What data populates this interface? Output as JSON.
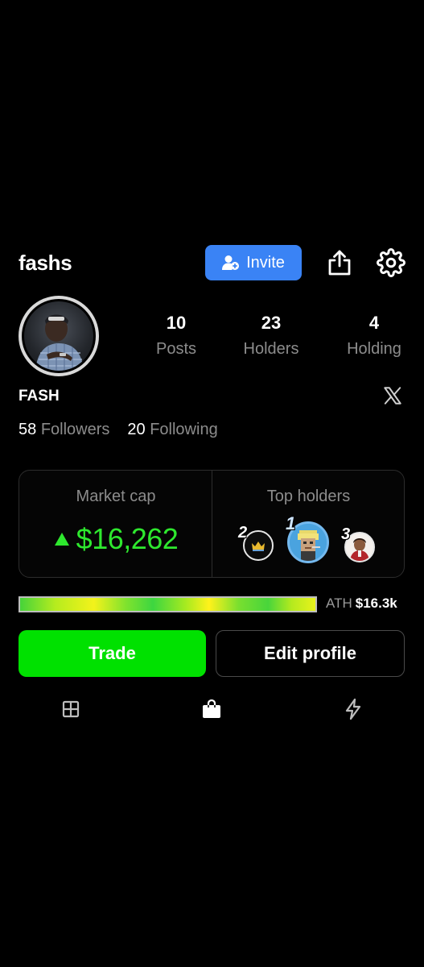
{
  "header": {
    "username": "fashs",
    "invite_label": "Invite",
    "share_icon": "share-icon",
    "settings_icon": "gear-icon",
    "accent_color": "#3a83f5"
  },
  "profile": {
    "display_name": "FASH",
    "stats": [
      {
        "value": "10",
        "label": "Posts"
      },
      {
        "value": "23",
        "label": "Holders"
      },
      {
        "value": "4",
        "label": "Holding"
      }
    ],
    "followers": {
      "count": "58",
      "label": "Followers"
    },
    "following": {
      "count": "20",
      "label": "Following"
    },
    "social_icon": "x-icon"
  },
  "market": {
    "market_cap_label": "Market cap",
    "market_cap_value": "$16,262",
    "trend": "up",
    "trend_color": "#2ee82e",
    "top_holders_label": "Top holders",
    "top_holders": [
      {
        "rank": "2"
      },
      {
        "rank": "1"
      },
      {
        "rank": "3"
      }
    ]
  },
  "ath": {
    "label": "ATH",
    "value": "$16.3k",
    "progress_fraction": 1.0
  },
  "actions": {
    "trade_label": "Trade",
    "edit_label": "Edit profile",
    "trade_color": "#00e100"
  },
  "tabs": [
    {
      "icon": "grid-icon",
      "active": false
    },
    {
      "icon": "shopping-bag-icon",
      "active": true
    },
    {
      "icon": "lightning-icon",
      "active": false
    }
  ]
}
